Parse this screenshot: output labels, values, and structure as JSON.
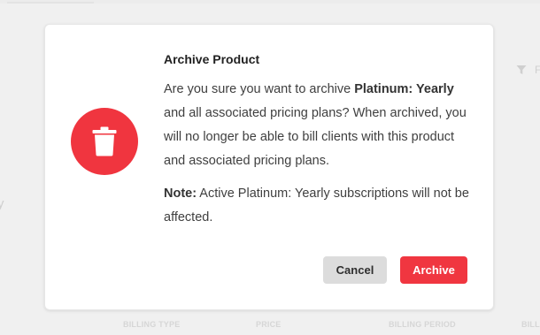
{
  "background": {
    "filter_label": "F",
    "side_text": "y",
    "columns": [
      "BILLING TYPE",
      "PRICE",
      "BILLING PERIOD",
      "BILL"
    ]
  },
  "modal": {
    "title": "Archive Product",
    "icon": "trash-icon",
    "body_prefix": "Are you sure you want to archive ",
    "product_name": "Platinum: Yearly",
    "body_suffix": " and all associated pricing plans? When archived, you will no longer be able to bill clients with this product and associated pricing plans.",
    "note_label": "Note:",
    "note_text": " Active Platinum: Yearly subscriptions will not be affected.",
    "cancel_label": "Cancel",
    "archive_label": "Archive"
  },
  "colors": {
    "danger": "#f0353f",
    "cancel_bg": "#dcdcdc",
    "backdrop": "#f0f0f0"
  }
}
